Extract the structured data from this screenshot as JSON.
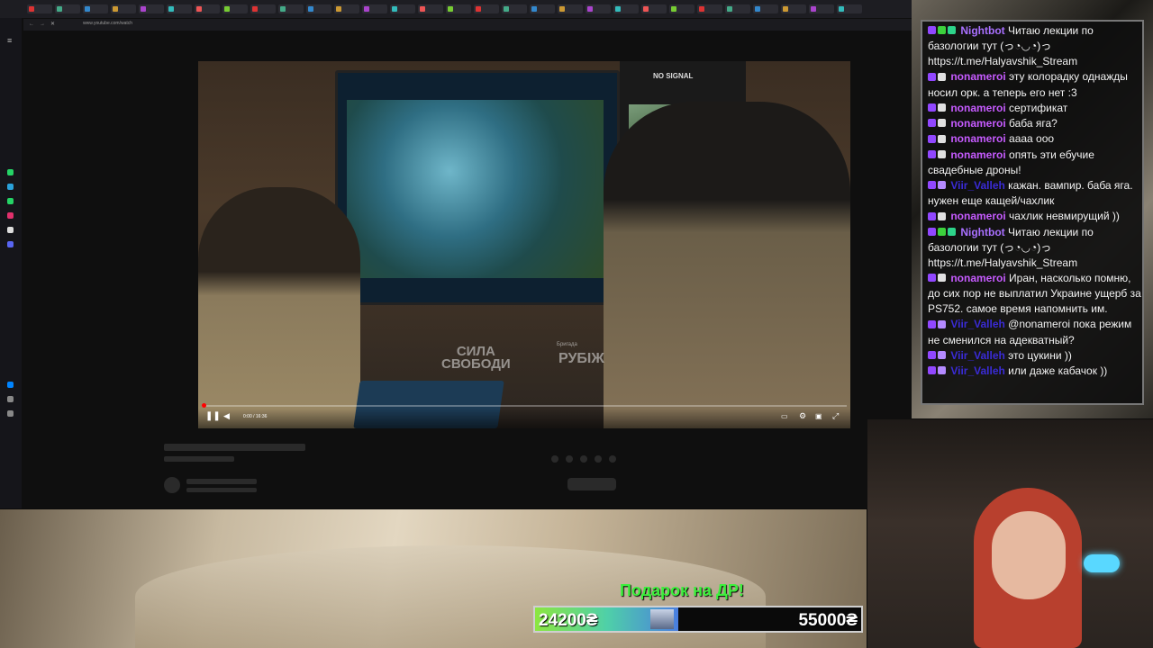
{
  "browser": {
    "url": "www.youtube.com/watch",
    "tab_count": 30,
    "sidebar_icons": [
      "whatsapp-icon",
      "telegram-icon",
      "instagram-icon",
      "x-icon",
      "discord-icon",
      "messenger-icon",
      "heart-icon",
      "history-icon",
      "settings-icon"
    ]
  },
  "video": {
    "time": "0:00 / 16:36",
    "no_signal": "NO SIGNAL",
    "watermark_1": "СИЛА\nСВОБОДИ",
    "watermark_2": "РУБІЖ",
    "watermark_2_small": "Бригада",
    "controls": [
      "pause-icon",
      "volume-icon",
      "subtitles-icon",
      "settings-icon",
      "miniplayer-icon",
      "fullscreen-icon"
    ]
  },
  "chat": {
    "messages": [
      {
        "user": "Nightbot",
        "color": "#a970ff",
        "badges": [
          "#9147ff",
          "#3cd23c",
          "#2dd48a"
        ],
        "text": "Читаю лекции по базологии тут (っ◔◡◔)っ https://t.me/Halyavshik_Stream"
      },
      {
        "user": "nonameroi",
        "color": "#c65bff",
        "badges": [
          "#9147ff",
          "#e0e0e0"
        ],
        "text": "эту колорадку однажды носил орк. а теперь его нет :3"
      },
      {
        "user": "nonameroi",
        "color": "#c65bff",
        "badges": [
          "#9147ff",
          "#e0e0e0"
        ],
        "text": "сертификат"
      },
      {
        "user": "nonameroi",
        "color": "#c65bff",
        "badges": [
          "#9147ff",
          "#e0e0e0"
        ],
        "text": "баба яга?"
      },
      {
        "user": "nonameroi",
        "color": "#c65bff",
        "badges": [
          "#9147ff",
          "#e0e0e0"
        ],
        "text": "аааа ооо"
      },
      {
        "user": "nonameroi",
        "color": "#c65bff",
        "badges": [
          "#9147ff",
          "#e0e0e0"
        ],
        "text": "опять эти ебучие свадебные дроны!"
      },
      {
        "user": "Viir_Valleh",
        "color": "#3a2bd6",
        "badges": [
          "#9147ff",
          "#b48aff"
        ],
        "text": "кажан. вампир. баба яга. нужен еще кащей/чахлик"
      },
      {
        "user": "nonameroi",
        "color": "#c65bff",
        "badges": [
          "#9147ff",
          "#e0e0e0"
        ],
        "text": "чахлик невмирущий ))"
      },
      {
        "user": "Nightbot",
        "color": "#a970ff",
        "badges": [
          "#9147ff",
          "#3cd23c",
          "#2dd48a"
        ],
        "text": "Читаю лекции по базологии тут (っ◔◡◔)っ https://t.me/Halyavshik_Stream"
      },
      {
        "user": "nonameroi",
        "color": "#c65bff",
        "badges": [
          "#9147ff",
          "#e0e0e0"
        ],
        "text": "Иран, насколько помню, до сих пор не выплатил Украине ущерб за PS752. самое время напомнить им."
      },
      {
        "user": "Viir_Valleh",
        "color": "#3a2bd6",
        "badges": [
          "#9147ff",
          "#b48aff"
        ],
        "text": "@nonameroi пока режим не сменился на адекватный?"
      },
      {
        "user": "Viir_Valleh",
        "color": "#3a2bd6",
        "badges": [
          "#9147ff",
          "#b48aff"
        ],
        "text": "это цукини ))"
      },
      {
        "user": "Viir_Valleh",
        "color": "#3a2bd6",
        "badges": [
          "#9147ff",
          "#b48aff"
        ],
        "text": "или даже кабачок ))"
      }
    ]
  },
  "donation": {
    "title": "Подарок на ДР!",
    "current": "24200₴",
    "goal": "55000₴",
    "progress": 0.44
  }
}
